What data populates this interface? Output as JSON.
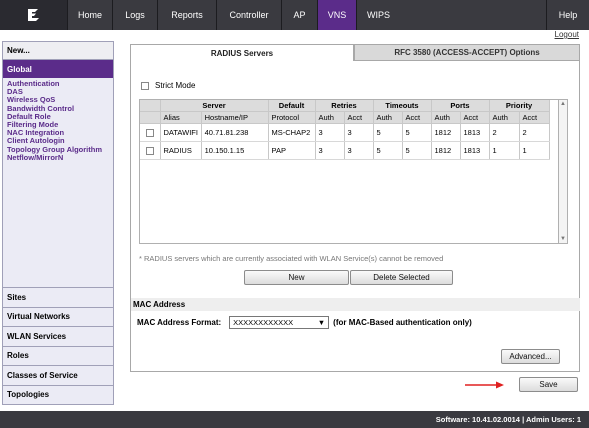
{
  "nav": {
    "items": [
      {
        "label": "Home"
      },
      {
        "label": "Logs"
      },
      {
        "label": "Reports"
      },
      {
        "label": "Controller"
      },
      {
        "label": "AP"
      },
      {
        "label": "VNS"
      },
      {
        "label": "WIPS"
      }
    ],
    "active": "VNS",
    "help": "Help",
    "logout": "Logout"
  },
  "sidebar": {
    "new_label": "New...",
    "global_label": "Global",
    "links": [
      "Authentication",
      "DAS",
      "Wireless QoS",
      "Bandwidth Control",
      "Default Role",
      "Filtering Mode",
      "NAC Integration",
      "Client Autologin",
      "Topology Group Algorithm",
      "Netflow/MirrorN"
    ],
    "sections": [
      "Sites",
      "Virtual Networks",
      "WLAN Services",
      "Roles",
      "Classes of Service",
      "Topologies"
    ]
  },
  "tabs": {
    "active": "RADIUS Servers",
    "inactive": "RFC 3580 (ACCESS-ACCEPT) Options"
  },
  "strict_mode": {
    "label": "Strict Mode",
    "checked": false
  },
  "table": {
    "groups": [
      "Server",
      "Default",
      "Retries",
      "Timeouts",
      "Ports",
      "Priority"
    ],
    "columns": [
      "Alias",
      "Hostname/IP",
      "Protocol",
      "Auth",
      "Acct",
      "Auth",
      "Acct",
      "Auth",
      "Acct",
      "Auth",
      "Acct"
    ],
    "rows": [
      [
        "DATAWIFI",
        "40.71.81.238",
        "MS-CHAP2",
        "3",
        "3",
        "5",
        "5",
        "1812",
        "1813",
        "2",
        "2"
      ],
      [
        "RADIUS",
        "10.150.1.15",
        "PAP",
        "3",
        "3",
        "5",
        "5",
        "1812",
        "1813",
        "1",
        "1"
      ]
    ]
  },
  "note": "* RADIUS servers which are currently associated with WLAN Service(s) cannot be removed",
  "buttons": {
    "new": "New",
    "delete": "Delete Selected",
    "advanced": "Advanced...",
    "save": "Save"
  },
  "mac": {
    "heading": "MAC Address",
    "format_label": "MAC Address Format:",
    "format_value": "XXXXXXXXXXXX",
    "hint": "(for MAC-Based authentication only)"
  },
  "footer": "Software: 10.41.02.0014 | Admin Users: 1",
  "colors": {
    "accent": "#5b2c8a",
    "topbar": "#3a3a40",
    "arrow": "#e02020"
  }
}
